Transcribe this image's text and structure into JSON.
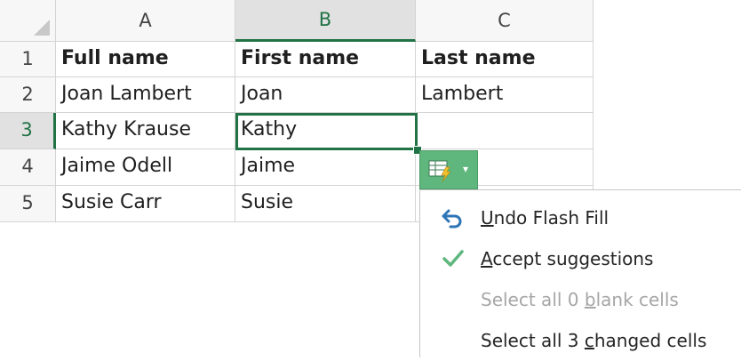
{
  "columns": [
    "A",
    "B",
    "C"
  ],
  "rows": [
    {
      "num": "1",
      "cells": [
        "Full name",
        "First name",
        "Last name"
      ]
    },
    {
      "num": "2",
      "cells": [
        "Joan Lambert",
        "Joan",
        "Lambert"
      ]
    },
    {
      "num": "3",
      "cells": [
        "Kathy Krause",
        "Kathy",
        ""
      ]
    },
    {
      "num": "4",
      "cells": [
        "Jaime Odell",
        "Jaime",
        ""
      ]
    },
    {
      "num": "5",
      "cells": [
        "Susie Carr",
        "Susie",
        ""
      ]
    }
  ],
  "active_cell": "B3",
  "flash_fill_button": {
    "icon": "flash-fill-options-icon",
    "caret": "▾"
  },
  "menu": {
    "items": [
      {
        "icon": "undo-arrow-icon",
        "pre": "",
        "key": "U",
        "post": "ndo Flash Fill",
        "enabled": true
      },
      {
        "icon": "checkmark-icon",
        "pre": "",
        "key": "A",
        "post": "ccept suggestions",
        "enabled": true
      },
      {
        "icon": "",
        "pre": "Select all 0 ",
        "key": "b",
        "post": "lank cells",
        "enabled": false
      },
      {
        "icon": "",
        "pre": "Select all 3 ",
        "key": "c",
        "post": "hanged cells",
        "enabled": true
      }
    ]
  },
  "colors": {
    "accent": "#217346",
    "button": "#5fb77e",
    "undo": "#2e75b6",
    "check": "#5fb77e"
  }
}
